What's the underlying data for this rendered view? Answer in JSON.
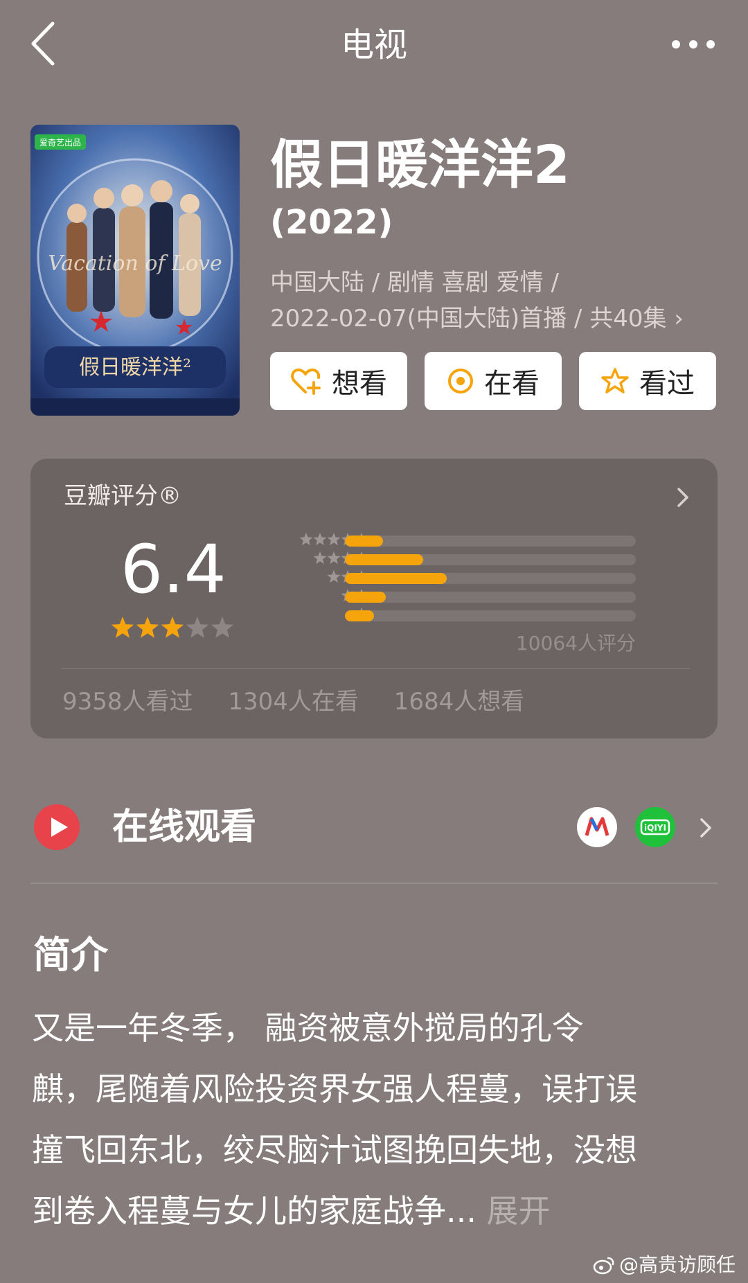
{
  "nav": {
    "title": "电视",
    "back_icon": "chevron-left-icon",
    "more_icon": "more-dots-icon"
  },
  "poster": {
    "badge": "爱奇艺出品",
    "logo_text": "假日暖洋洋²",
    "script_text": "Vacation of Love"
  },
  "show": {
    "title": "假日暖洋洋2",
    "year": "(2022)",
    "meta_line1": "中国大陆 / 剧情 喜剧 爱情 /",
    "meta_line2": "2022-02-07(中国大陆)首播 / 共40集 ›"
  },
  "actions": {
    "want": "想看",
    "watching": "在看",
    "watched": "看过"
  },
  "rating": {
    "label": "豆瓣评分®",
    "score": "6.4",
    "score_stars": 3,
    "distribution": [
      {
        "stars": 5,
        "fraction": 0.13
      },
      {
        "stars": 4,
        "fraction": 0.27
      },
      {
        "stars": 3,
        "fraction": 0.35
      },
      {
        "stars": 2,
        "fraction": 0.14
      },
      {
        "stars": 1,
        "fraction": 0.1
      }
    ],
    "raters": "10064人评分",
    "counts": [
      "9358人看过",
      "1304人在看",
      "1684人想看"
    ]
  },
  "online": {
    "label": "在线观看",
    "platforms": [
      "migu-icon",
      "iqiyi-icon"
    ],
    "iqiyi_text": "iQIYI"
  },
  "intro": {
    "heading": "简介",
    "lines": [
      "又是一年冬季， 融资被意外搅局的孔令",
      "麒，尾随着风险投资界女强人程蔓，误打误",
      "撞飞回东北，绞尽脑汁试图挽回失地，没想",
      "到卷入程蔓与女儿的家庭战争..."
    ],
    "expand": "展开"
  },
  "watermark": "@高贵访顾任",
  "colors": {
    "accent": "#f6a40c",
    "play": "#e8424b",
    "background": "#857c7b",
    "card": "#6c6463"
  }
}
